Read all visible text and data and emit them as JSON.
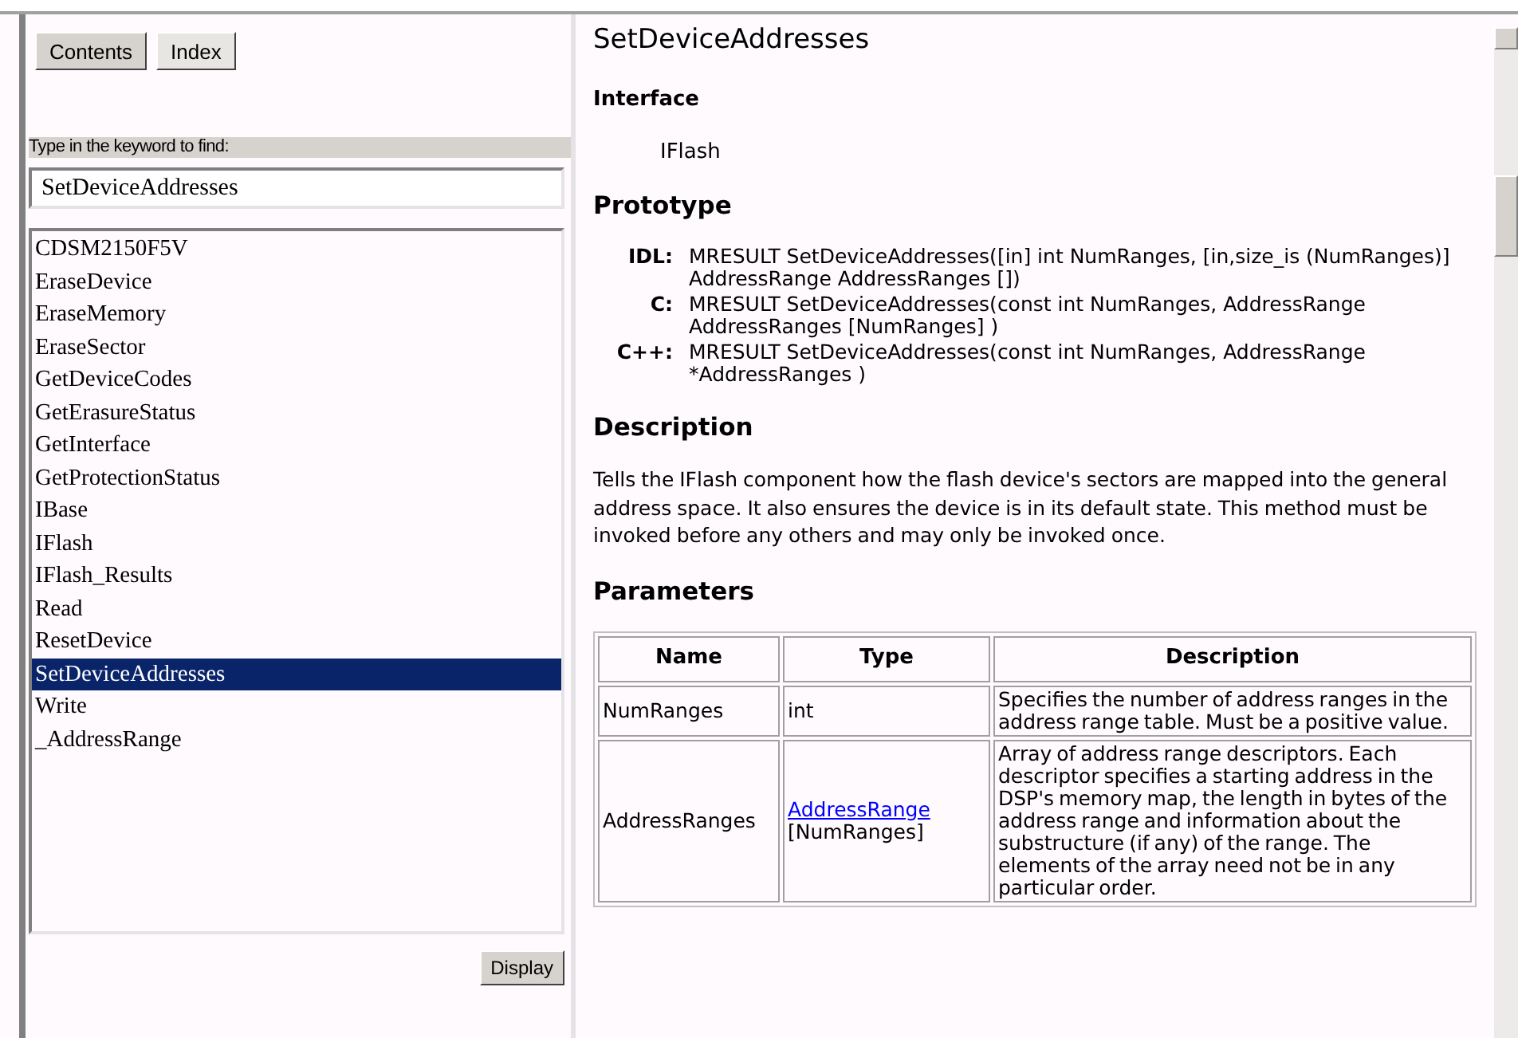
{
  "navigation": {
    "tabs": [
      {
        "label": "Contents",
        "selected": false
      },
      {
        "label": "Index",
        "selected": true
      }
    ],
    "keyword_label": "Type in the keyword to find:",
    "keyword_value": "SetDeviceAddresses",
    "index_items": [
      {
        "label": "CDSM2150F5V",
        "selected": false
      },
      {
        "label": "EraseDevice",
        "selected": false
      },
      {
        "label": "EraseMemory",
        "selected": false
      },
      {
        "label": "EraseSector",
        "selected": false
      },
      {
        "label": "GetDeviceCodes",
        "selected": false
      },
      {
        "label": "GetErasureStatus",
        "selected": false
      },
      {
        "label": "GetInterface",
        "selected": false
      },
      {
        "label": "GetProtectionStatus",
        "selected": false
      },
      {
        "label": "IBase",
        "selected": false
      },
      {
        "label": "IFlash",
        "selected": false
      },
      {
        "label": "IFlash_Results",
        "selected": false
      },
      {
        "label": "Read",
        "selected": false
      },
      {
        "label": "ResetDevice",
        "selected": false
      },
      {
        "label": "SetDeviceAddresses",
        "selected": true
      },
      {
        "label": "Write",
        "selected": false
      },
      {
        "label": "_AddressRange",
        "selected": false
      }
    ],
    "display_button": "Display"
  },
  "topic": {
    "title": "SetDeviceAddresses",
    "interface_heading": "Interface",
    "interface_name": "IFlash",
    "prototype_heading": "Prototype",
    "prototypes": [
      {
        "lang": "IDL:",
        "signature": "MRESULT SetDeviceAddresses([in] int NumRanges, [in,size_is (NumRanges)] AddressRange AddressRanges [])"
      },
      {
        "lang": "C:",
        "signature": "MRESULT SetDeviceAddresses(const int NumRanges, AddressRange AddressRanges [NumRanges] )"
      },
      {
        "lang": "C++:",
        "signature": "MRESULT SetDeviceAddresses(const int NumRanges, AddressRange *AddressRanges )"
      }
    ],
    "description_heading": "Description",
    "description": "Tells the IFlash component how the flash device's sectors are mapped into the general address space. It also ensures the device is in its default state. This method must be invoked before any others and may only be invoked once.",
    "parameters_heading": "Parameters",
    "parameters": {
      "columns": [
        "Name",
        "Type",
        "Description"
      ],
      "rows": [
        {
          "name": "NumRanges",
          "type_link": null,
          "type": "int",
          "description": "Specifies the number of address ranges in the address range table. Must be a positive value."
        },
        {
          "name": "AddressRanges",
          "type_link": "AddressRange",
          "type": "[NumRanges]",
          "description": "Array of address range descriptors. Each descriptor specifies a starting address in the DSP's memory map, the length in bytes of the address range and information about the substructure (if any) of the range. The elements of the array need not be in any particular order."
        }
      ]
    }
  }
}
